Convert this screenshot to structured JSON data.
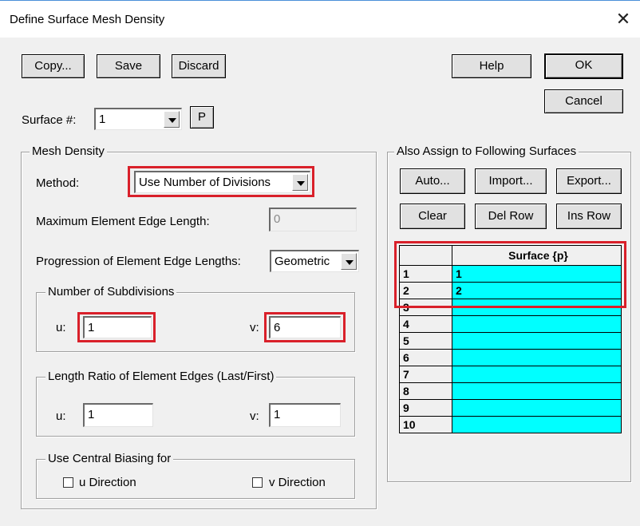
{
  "window": {
    "title": "Define Surface Mesh Density"
  },
  "toolbar": {
    "copy": "Copy...",
    "save": "Save",
    "discard": "Discard",
    "help": "Help",
    "ok": "OK",
    "cancel": "Cancel"
  },
  "surface": {
    "label": "Surface #:",
    "value": "1",
    "p_button": "P"
  },
  "mesh": {
    "group_title": "Mesh Density",
    "method_label": "Method:",
    "method_value": "Use Number of Divisions",
    "max_edge_label": "Maximum Element Edge Length:",
    "max_edge_value": "0",
    "progression_label": "Progression of Element Edge Lengths:",
    "progression_value": "Geometric",
    "subdiv": {
      "title": "Number of Subdivisions",
      "u_label": "u:",
      "u_value": "1",
      "v_label": "v:",
      "v_value": "6"
    },
    "ratio": {
      "title": "Length Ratio of Element Edges (Last/First)",
      "u_label": "u:",
      "u_value": "1",
      "v_label": "v:",
      "v_value": "1"
    },
    "biasing": {
      "title": "Use Central Biasing for",
      "u_label": "u Direction",
      "v_label": "v Direction",
      "u_checked": false,
      "v_checked": false
    }
  },
  "assign": {
    "group_title": "Also Assign to Following Surfaces",
    "buttons": {
      "auto": "Auto...",
      "import": "Import...",
      "export": "Export...",
      "clear": "Clear",
      "del_row": "Del Row",
      "ins_row": "Ins Row"
    },
    "grid": {
      "header": "Surface {p}",
      "rows": [
        {
          "n": "1",
          "value": "1"
        },
        {
          "n": "2",
          "value": "2"
        },
        {
          "n": "3",
          "value": ""
        },
        {
          "n": "4",
          "value": ""
        },
        {
          "n": "5",
          "value": ""
        },
        {
          "n": "6",
          "value": ""
        },
        {
          "n": "7",
          "value": ""
        },
        {
          "n": "8",
          "value": ""
        },
        {
          "n": "9",
          "value": ""
        },
        {
          "n": "10",
          "value": ""
        }
      ]
    }
  },
  "colors": {
    "grid_cell": "#00ffff",
    "highlight": "#d9202a",
    "dialog_bg": "#f0f0f0"
  }
}
